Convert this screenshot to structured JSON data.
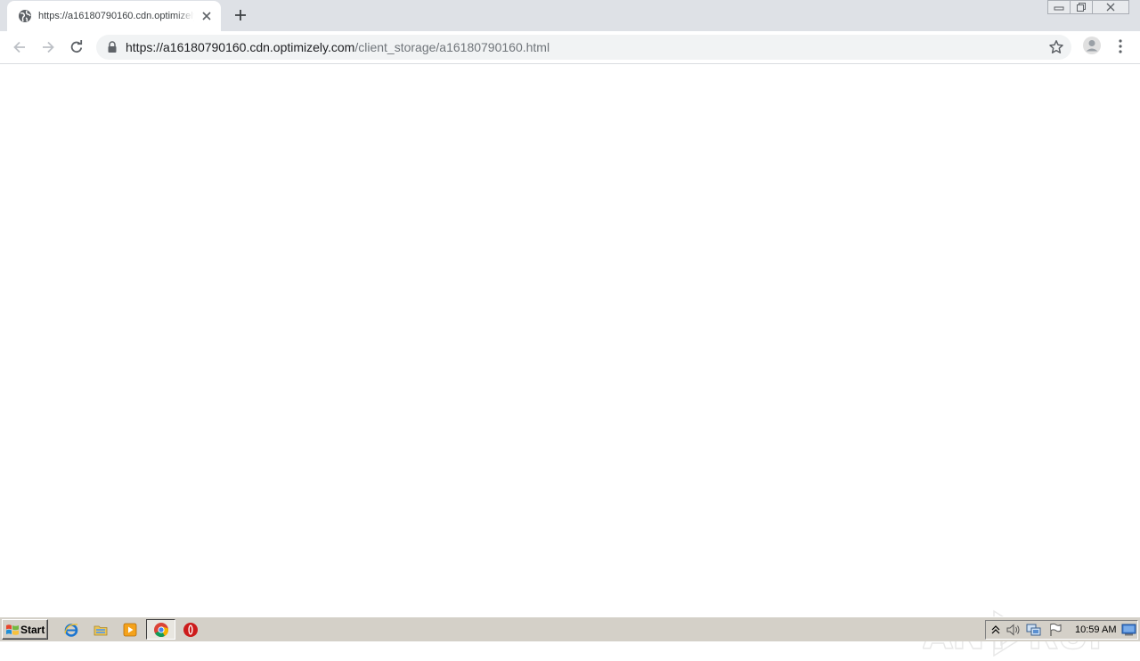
{
  "browser": {
    "tab": {
      "title": "https://a16180790160.cdn.optimizely",
      "favicon": "globe-icon"
    },
    "address_bar": {
      "url_host": "https://a16180790160.cdn.optimizely.com",
      "url_path": "/client_storage/a16180790160.html",
      "security_icon": "lock-icon"
    },
    "toolbar_icons": [
      "back-arrow-icon",
      "forward-arrow-icon",
      "reload-icon",
      "bookmark-star-icon",
      "profile-avatar-icon",
      "kebab-menu-icon"
    ]
  },
  "watermark": {
    "left_text": "ANY",
    "right_text": "RUN"
  },
  "taskbar": {
    "start_label": "Start",
    "pinned": [
      "internet-explorer-icon",
      "windows-explorer-icon",
      "media-player-icon",
      "chrome-icon",
      "opera-icon"
    ],
    "active_app": "chrome",
    "tray_icons": [
      "show-hidden-icons-chevron",
      "volume-icon",
      "network-icon",
      "action-center-flag-icon"
    ],
    "clock": "10:59 AM"
  },
  "colors": {
    "tabstrip_bg": "#dee1e6",
    "omnibox_bg": "#f1f3f4",
    "taskbar_bg": "#d4d0c8"
  }
}
